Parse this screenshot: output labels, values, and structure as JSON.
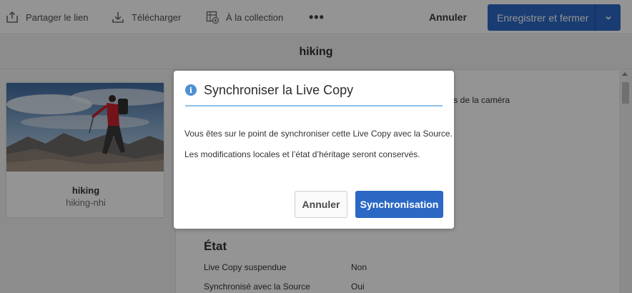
{
  "toolbar": {
    "share_label": "Partager le lien",
    "share_icon": "share-icon",
    "download_label": "Télécharger",
    "download_icon": "download-icon",
    "collection_label": "À la collection",
    "collection_icon": "add-to-collection-icon",
    "more_label": "•••",
    "cancel_label": "Annuler",
    "save_label": "Enregistrer et fermer",
    "save_caret_icon": "chevron-down-icon"
  },
  "title": "hiking",
  "asset_card": {
    "title": "hiking",
    "subtitle": "hiking-nhi"
  },
  "content": {
    "camera_text": "ées de la caméra",
    "state_title": "État",
    "properties": [
      {
        "label": "Live Copy suspendue",
        "value": "Non"
      },
      {
        "label": "Synchronisé avec la Source",
        "value": "Oui"
      }
    ]
  },
  "dialog": {
    "icon": "info-icon",
    "title": "Synchroniser la Live Copy",
    "message1": "Vous êtes sur le point de synchroniser cette Live Copy avec la Source.",
    "message2": "Les modifications locales et l’état d’héritage seront conservés.",
    "cancel_label": "Annuler",
    "sync_label": "Synchronisation"
  },
  "colors": {
    "accent": "#2b68c4",
    "info": "#4e8fd6",
    "divider": "#8fbfe8"
  }
}
